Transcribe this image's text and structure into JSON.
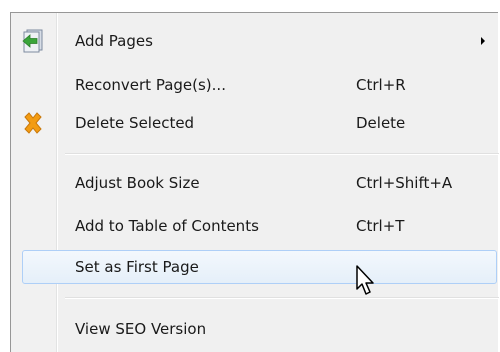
{
  "menu": {
    "items": [
      {
        "label": "Add Pages",
        "shortcut": "",
        "icon": "add-pages-icon",
        "submenu": true
      },
      {
        "label": "Reconvert Page(s)...",
        "shortcut": "Ctrl+R"
      },
      {
        "label": "Delete Selected",
        "shortcut": "Delete",
        "icon": "delete-x-icon"
      },
      {
        "label": "Adjust Book Size",
        "shortcut": "Ctrl+Shift+A"
      },
      {
        "label": "Add to Table of Contents",
        "shortcut": "Ctrl+T"
      },
      {
        "label": "Set as First Page",
        "shortcut": "",
        "highlighted": true
      },
      {
        "label": "View SEO Version",
        "shortcut": ""
      }
    ]
  },
  "colors": {
    "menu_background": "#f0f0f0",
    "highlight_border": "#aecff7",
    "delete_icon": "#f39c12",
    "add_pages_icon_green": "#3aa53a"
  }
}
